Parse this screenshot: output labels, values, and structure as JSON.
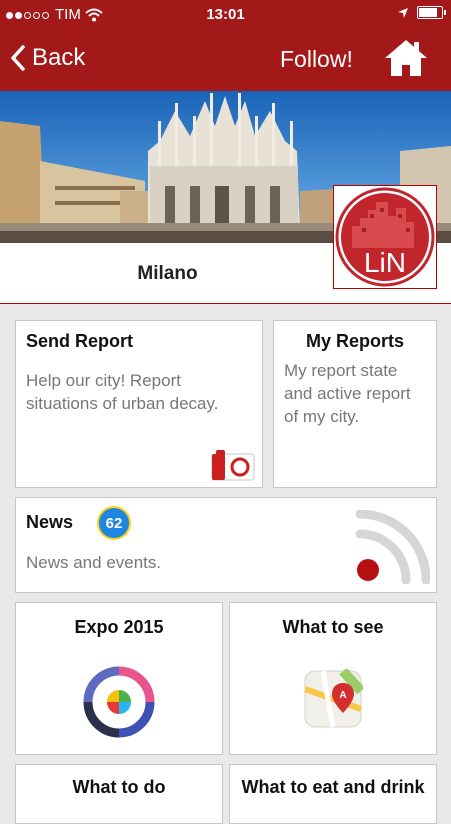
{
  "status_bar": {
    "carrier": "TIM",
    "time": "13:01",
    "signal_bars_filled": 2,
    "signal_bars_total": 5,
    "battery_level": 0.9
  },
  "nav": {
    "back_label": "Back",
    "follow_label": "Follow!",
    "home_icon": "home-icon",
    "back_icon": "chevron-left-icon"
  },
  "city": {
    "name": "Milano",
    "logo_text": "LiN"
  },
  "tiles": {
    "send_report": {
      "title": "Send Report",
      "description": "Help our city! Report situations of urban decay.",
      "icon": "camera-icon"
    },
    "my_reports": {
      "title": "My Reports",
      "description": "My report state and active report of my city."
    },
    "news": {
      "title": "News",
      "badge": "62",
      "description": "News and events.",
      "icon": "rss-icon"
    },
    "expo": {
      "title": "Expo 2015",
      "icon": "expo-logo-icon"
    },
    "what_to_see": {
      "title": "What to see",
      "icon": "map-pin-icon"
    },
    "what_to_do": {
      "title": "What to do"
    },
    "what_to_eat": {
      "title": "What to eat and drink"
    }
  },
  "colors": {
    "brand_red": "#a31818",
    "badge_blue": "#1e86e0",
    "badge_ring": "#ffd21a"
  }
}
